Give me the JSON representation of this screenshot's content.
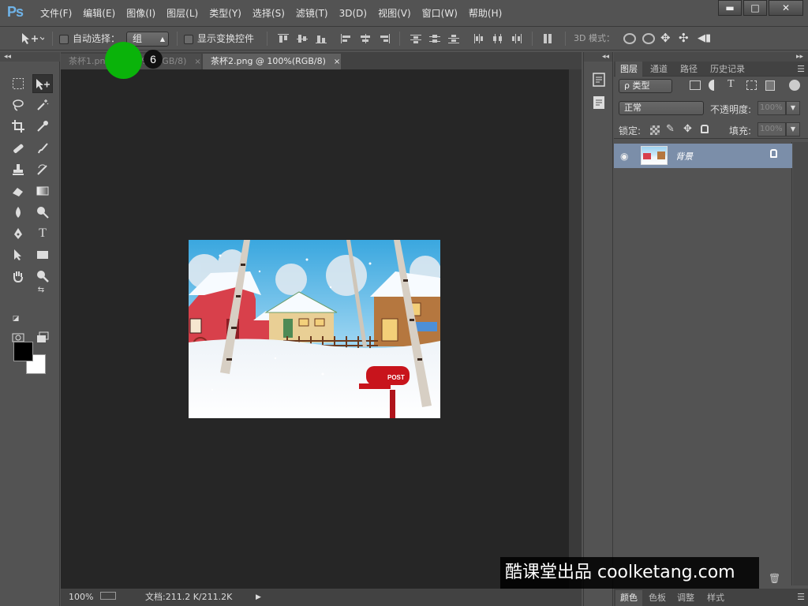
{
  "app": {
    "logo": "Ps"
  },
  "menu": [
    "文件(F)",
    "编辑(E)",
    "图像(I)",
    "图层(L)",
    "类型(Y)",
    "选择(S)",
    "滤镜(T)",
    "3D(D)",
    "视图(V)",
    "窗口(W)",
    "帮助(H)"
  ],
  "window_controls": {
    "minimize": "▬",
    "maximize": "□",
    "close": "✕"
  },
  "options": {
    "auto_select_label": "自动选择：",
    "auto_select_value": "组",
    "show_transform_label": "显示变换控件",
    "mode_3d_label": "3D 模式："
  },
  "tabs": [
    {
      "label": "茶杯1.png @ 100% (RGB/8)",
      "close": "×"
    },
    {
      "label": "茶杯2.png @ 100%(RGB/8)",
      "close": "×"
    }
  ],
  "step_badge": "6",
  "status": {
    "zoom": "100%",
    "doc_info": "文档:211.2 K/211.2K",
    "arrow": "▶"
  },
  "layers_panel": {
    "tabs": [
      "图层",
      "通道",
      "路径",
      "历史记录"
    ],
    "filter_label": "ρ 类型",
    "blend_mode": "正常",
    "opacity_label": "不透明度:",
    "opacity_value": "100%",
    "lock_label": "锁定:",
    "fill_label": "填充:",
    "fill_value": "100%",
    "layer": {
      "name": "背景"
    }
  },
  "bottom_tabs": [
    "颜色",
    "色板",
    "调整",
    "样式"
  ],
  "image_text": {
    "mailbox": "POST"
  },
  "watermark": "酷课堂出品 coolketang.com"
}
